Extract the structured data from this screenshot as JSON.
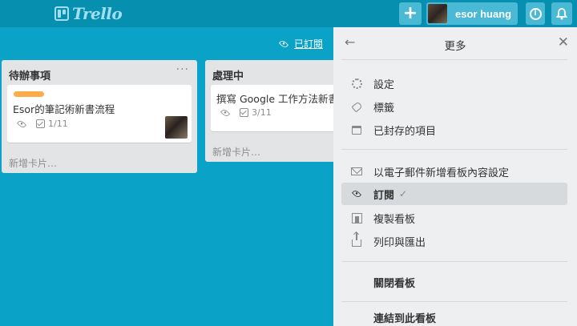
{
  "header": {
    "logo_text": "Trello",
    "add_label": "+",
    "user_name": "esor huang",
    "info_label": "i"
  },
  "board": {
    "subscribed_label": "已訂閱",
    "lists": [
      {
        "title": "待辦事項",
        "menu": "···",
        "cards": [
          {
            "title": "Esor的筆記術新書流程",
            "label_color": "#ffab4a",
            "checklist": "1/11"
          }
        ],
        "add_card": "新增卡片…"
      },
      {
        "title": "處理中",
        "cards": [
          {
            "title": "撰寫 Google 工作方法新書",
            "checklist": "3/11"
          }
        ],
        "add_card": "新增卡片…"
      }
    ]
  },
  "menu": {
    "title": "更多",
    "back_icon": "←",
    "close_icon": "✕",
    "items": [
      {
        "icon": "gear-icon",
        "label": "設定"
      },
      {
        "icon": "tag-icon",
        "label": "標籤"
      },
      {
        "icon": "archive-icon",
        "label": "已封存的項目"
      },
      {
        "icon": "mail-icon",
        "label": "以電子郵件新增看板內容設定"
      },
      {
        "icon": "eye-icon",
        "label": "訂閱",
        "checked": "✓"
      },
      {
        "icon": "copy-icon",
        "label": "複製看板"
      },
      {
        "icon": "share-icon",
        "label": "列印與匯出"
      },
      {
        "label": "關閉看板"
      },
      {
        "label": "連結到此看板"
      }
    ]
  },
  "colors": {
    "header_bg": "#078fb0",
    "board_bg": "#0aa3c7",
    "panel_bg": "#edeff0",
    "label_orange": "#ffab4a"
  }
}
